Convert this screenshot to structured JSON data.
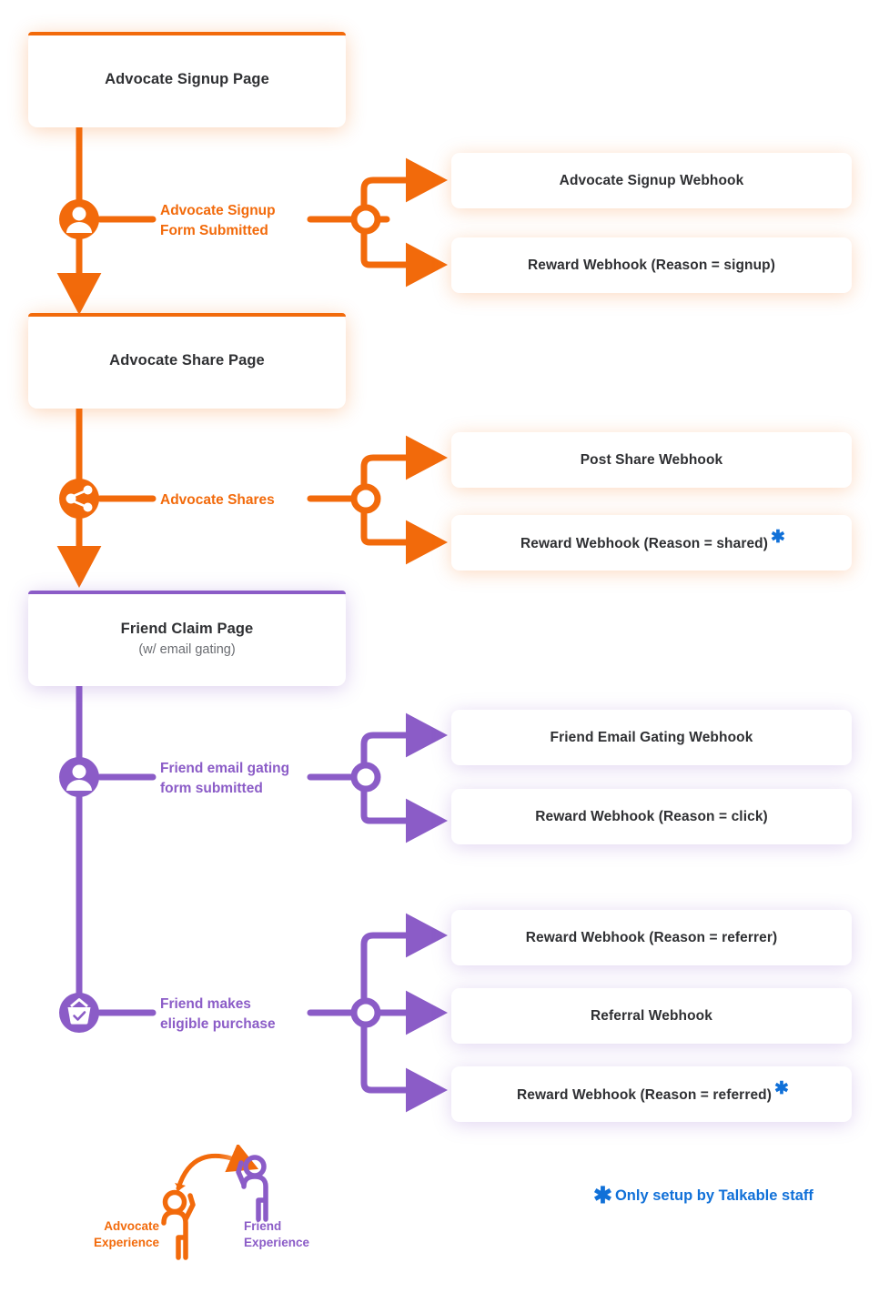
{
  "colors": {
    "advocate": "#F26A0B",
    "friend": "#8B5CC7",
    "note": "#1070D8",
    "text": "#2f3033",
    "subtext": "#6b6d72"
  },
  "pages": [
    {
      "id": "advocate-signup-page",
      "title": "Advocate Signup Page",
      "sub": "",
      "track": "advocate"
    },
    {
      "id": "advocate-share-page",
      "title": "Advocate Share Page",
      "sub": "",
      "track": "advocate"
    },
    {
      "id": "friend-claim-page",
      "title": "Friend Claim Page",
      "sub": "(w/ email gating)",
      "track": "friend"
    }
  ],
  "events": [
    {
      "id": "advocate-signup-form-submitted",
      "line1": "Advocate Signup",
      "line2": "Form Submitted",
      "track": "advocate",
      "icon": "user-icon"
    },
    {
      "id": "advocate-shares",
      "line1": "Advocate Shares",
      "line2": "",
      "track": "advocate",
      "icon": "share-icon"
    },
    {
      "id": "friend-email-gating-form-submitted",
      "line1": "Friend email gating",
      "line2": "form submitted",
      "track": "friend",
      "icon": "user-icon"
    },
    {
      "id": "friend-makes-eligible-purchase",
      "line1": "Friend makes",
      "line2": "eligible purchase",
      "track": "friend",
      "icon": "basket-check-icon"
    }
  ],
  "webhooks": {
    "signup": [
      {
        "label": "Advocate Signup Webhook",
        "starred": false
      },
      {
        "label": "Reward Webhook (Reason = signup)",
        "starred": false
      }
    ],
    "share": [
      {
        "label": "Post Share Webhook",
        "starred": false
      },
      {
        "label": "Reward Webhook (Reason = shared)",
        "starred": true
      }
    ],
    "gating": [
      {
        "label": "Friend Email Gating Webhook",
        "starred": false
      },
      {
        "label": "Reward Webhook (Reason = click)",
        "starred": false
      }
    ],
    "purchase": [
      {
        "label": "Reward Webhook (Reason = referrer)",
        "starred": false
      },
      {
        "label": "Referral Webhook",
        "starred": false
      },
      {
        "label": "Reward Webhook (Reason = referred)",
        "starred": true
      }
    ]
  },
  "star_symbol": "✱",
  "legend": {
    "advocate": {
      "line1": "Advocate",
      "line2": "Experience"
    },
    "friend": {
      "line1": "Friend",
      "line2": "Experience"
    }
  },
  "footnote": {
    "star": "✱",
    "text": "Only setup by Talkable staff"
  }
}
